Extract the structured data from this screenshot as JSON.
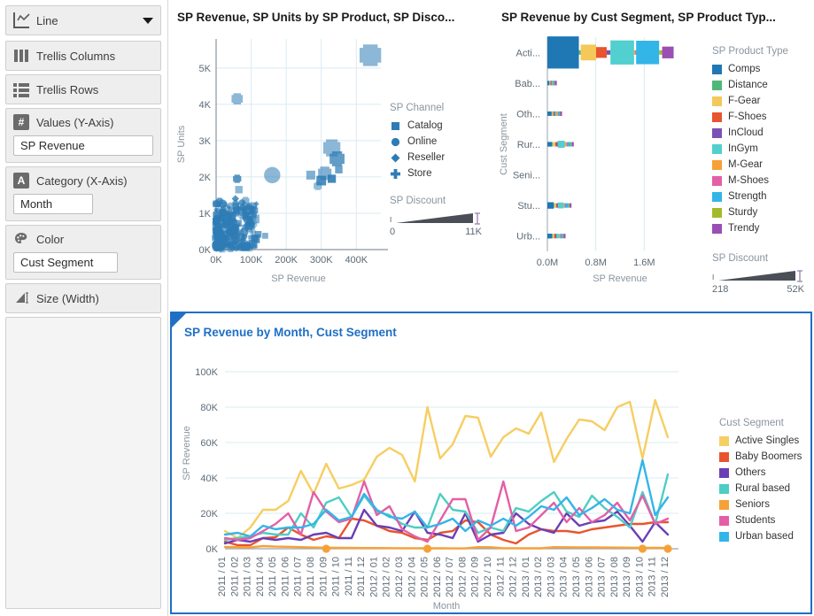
{
  "sidebar": {
    "chart_type": {
      "label": "Line",
      "icon": "line-chart-icon",
      "caret": "chevron-down-icon"
    },
    "shelves": [
      {
        "label": "Trellis Columns",
        "icon": "trellis-columns-icon"
      },
      {
        "label": "Trellis Rows",
        "icon": "trellis-rows-icon"
      }
    ],
    "values": {
      "label": "Values (Y-Axis)",
      "icon": "measure-icon",
      "field": "SP Revenue"
    },
    "category": {
      "label": "Category (X-Axis)",
      "icon": "attribute-icon",
      "field": "Month"
    },
    "color": {
      "label": "Color",
      "icon": "palette-icon",
      "field": "Cust Segment"
    },
    "size": {
      "label": "Size (Width)",
      "icon": "size-icon"
    }
  },
  "scatter": {
    "title": "SP Revenue, SP Units by SP Product, SP Disco...",
    "legend_channel_title": "SP Channel",
    "legend_discount_title": "SP Discount",
    "discount_min": "0",
    "discount_max": "11K"
  },
  "bars": {
    "title": "SP Revenue by Cust Segment, SP Product Typ...",
    "legend_title": "SP Product Type",
    "legend_discount_title": "SP Discount",
    "discount_min": "218",
    "discount_max": "52K"
  },
  "lines": {
    "title": "SP Revenue by Month, Cust Segment",
    "legend_title": "Cust Segment"
  },
  "chart_data": [
    {
      "id": "scatter",
      "type": "scatter",
      "title": "SP Revenue, SP Units by SP Product, SP Disco...",
      "xlabel": "SP Revenue",
      "ylabel": "SP Units",
      "xlim": [
        0,
        470000
      ],
      "ylim": [
        0,
        5800
      ],
      "xticks": [
        "0K",
        "100K",
        "200K",
        "300K",
        "400K"
      ],
      "xtickvals": [
        0,
        100000,
        200000,
        300000,
        400000
      ],
      "yticks": [
        "0K",
        "1K",
        "2K",
        "3K",
        "4K",
        "5K"
      ],
      "ytickvals": [
        0,
        1000,
        2000,
        3000,
        4000,
        5000
      ],
      "grid": true,
      "legend_position": "right",
      "legend_title": "SP Channel",
      "legend": [
        {
          "name": "Catalog",
          "marker": "square",
          "color": "#2e7cb5"
        },
        {
          "name": "Online",
          "marker": "circle",
          "color": "#2e7cb5"
        },
        {
          "name": "Reseller",
          "marker": "diamond",
          "color": "#2e7cb5"
        },
        {
          "name": "Store",
          "marker": "cross",
          "color": "#2e7cb5"
        }
      ],
      "size_legend": {
        "title": "SP Discount",
        "min": 0,
        "max": 11000,
        "min_label": "0",
        "max_label": "11K"
      },
      "points": [
        {
          "x": 440000,
          "y": 5350,
          "size": 58,
          "marker": "cross",
          "opacity": 0.55
        },
        {
          "x": 60000,
          "y": 4150,
          "size": 30,
          "marker": "cross",
          "opacity": 0.55
        },
        {
          "x": 330000,
          "y": 2800,
          "size": 46,
          "marker": "cross",
          "opacity": 0.55
        },
        {
          "x": 345000,
          "y": 2500,
          "size": 40,
          "marker": "cross",
          "opacity": 0.75
        },
        {
          "x": 310000,
          "y": 2100,
          "size": 36,
          "marker": "cross",
          "opacity": 0.6
        },
        {
          "x": 300000,
          "y": 1900,
          "size": 26,
          "marker": "square",
          "opacity": 0.85
        },
        {
          "x": 160000,
          "y": 2050,
          "size": 44,
          "marker": "circle",
          "opacity": 0.55
        },
        {
          "x": 270000,
          "y": 2050,
          "size": 24,
          "marker": "square",
          "opacity": 0.6
        },
        {
          "x": 330000,
          "y": 1950,
          "size": 22,
          "marker": "square",
          "opacity": 0.9
        },
        {
          "x": 350000,
          "y": 2200,
          "size": 20,
          "marker": "square",
          "opacity": 0.7
        },
        {
          "x": 290000,
          "y": 1750,
          "size": 22,
          "marker": "cross",
          "opacity": 0.5
        },
        {
          "x": 60000,
          "y": 1950,
          "size": 22,
          "marker": "cross",
          "opacity": 0.8
        },
        {
          "x": 65000,
          "y": 1650,
          "size": 20,
          "marker": "square",
          "opacity": 0.55
        },
        {
          "x": 55000,
          "y": 1400,
          "size": 20,
          "marker": "diamond",
          "opacity": 0.8
        },
        {
          "x": 80000,
          "y": 1250,
          "size": 22,
          "marker": "diamond",
          "opacity": 0.5
        },
        {
          "x": 95000,
          "y": 1200,
          "size": 20,
          "marker": "diamond",
          "opacity": 0.7
        },
        {
          "x": 75000,
          "y": 1050,
          "size": 26,
          "marker": "circle",
          "opacity": 0.7
        },
        {
          "x": 45000,
          "y": 900,
          "size": 22,
          "marker": "square",
          "opacity": 0.85
        },
        {
          "x": 30000,
          "y": 700,
          "size": 24,
          "marker": "circle",
          "opacity": 0.9
        },
        {
          "x": 120000,
          "y": 420,
          "size": 18,
          "marker": "square",
          "opacity": 0.7
        },
        {
          "x": 140000,
          "y": 380,
          "size": 16,
          "marker": "square",
          "opacity": 0.6
        },
        {
          "x": 20000,
          "y": 300,
          "size": 26,
          "marker": "circle",
          "opacity": 0.95
        },
        {
          "x": 35000,
          "y": 500,
          "size": 22,
          "marker": "diamond",
          "opacity": 0.9
        },
        {
          "x": 50000,
          "y": 600,
          "size": 20,
          "marker": "square",
          "opacity": 0.8
        },
        {
          "x": 15000,
          "y": 200,
          "size": 24,
          "marker": "cross",
          "opacity": 0.95
        },
        {
          "x": 90000,
          "y": 800,
          "size": 22,
          "marker": "circle",
          "opacity": 0.6
        },
        {
          "x": 100000,
          "y": 650,
          "size": 20,
          "marker": "square",
          "opacity": 0.65
        },
        {
          "x": 25000,
          "y": 150,
          "size": 22,
          "marker": "diamond",
          "opacity": 0.9
        },
        {
          "x": 10000,
          "y": 420,
          "size": 20,
          "marker": "square",
          "opacity": 0.9
        },
        {
          "x": 70000,
          "y": 350,
          "size": 20,
          "marker": "cross",
          "opacity": 0.7
        }
      ]
    },
    {
      "id": "stacked_bars",
      "type": "bar",
      "orientation": "horizontal",
      "stacked": true,
      "title": "SP Revenue by Cust Segment, SP Product Typ...",
      "xlabel": "SP Revenue",
      "ylabel": "Cust Segment",
      "xlim": [
        0,
        2400000
      ],
      "xticks": [
        "0.0M",
        "0.8M",
        "1.6M"
      ],
      "xtickvals": [
        0,
        800000,
        1600000
      ],
      "categories": [
        "Acti...",
        "Bab...",
        "Oth...",
        "Rur...",
        "Seni...",
        "Stu...",
        "Urb..."
      ],
      "legend_title": "SP Product Type",
      "legend_position": "right",
      "series": [
        {
          "name": "Comps",
          "color": "#1f77b4",
          "values": [
            520000,
            30000,
            70000,
            75000,
            0,
            105000,
            78000
          ]
        },
        {
          "name": "Distance",
          "color": "#4fb878",
          "values": [
            30000,
            6000,
            8000,
            14000,
            0,
            10000,
            9000
          ]
        },
        {
          "name": "F-Gear",
          "color": "#f6c council",
          "values": [
            0,
            0,
            0,
            0,
            0,
            0,
            0
          ]
        },
        {
          "name": "F-Shoes",
          "color": "#e8542e",
          "values": [
            175000,
            10000,
            14000,
            26000,
            0,
            16000,
            22000
          ]
        },
        {
          "name": "InCloud",
          "color": "#7b51b5",
          "values": [
            62000,
            8000,
            12000,
            16000,
            0,
            14000,
            12000
          ]
        },
        {
          "name": "InGym",
          "color": "#52cfcf",
          "values": [
            390000,
            22000,
            30000,
            115000,
            0,
            95000,
            52000
          ]
        },
        {
          "name": "M-Gear",
          "color": "#f6a138",
          "values": [
            22000,
            5000,
            20000,
            32000,
            0,
            16000,
            14000
          ]
        },
        {
          "name": "M-Shoes",
          "color": "#e35fa6",
          "values": [
            12000,
            5000,
            6000,
            10000,
            0,
            8000,
            7000
          ]
        },
        {
          "name": "Strength",
          "color": "#33b5e8",
          "values": [
            380000,
            18000,
            22000,
            58000,
            0,
            62000,
            38000
          ]
        },
        {
          "name": "Sturdy",
          "color": "#a2bb2a",
          "values": [
            50000,
            6000,
            8000,
            18000,
            0,
            12000,
            10000
          ]
        },
        {
          "name": "Trendy",
          "color": "#9a4fb5",
          "values": [
            190000,
            10000,
            16000,
            32000,
            0,
            26000,
            18000
          ]
        }
      ],
      "size_legend": {
        "title": "SP Discount",
        "min": 218,
        "max": 52000,
        "min_label": "218",
        "max_label": "52K"
      }
    },
    {
      "id": "line_by_month",
      "type": "line",
      "title": "SP Revenue by Month, Cust Segment",
      "xlabel": "Month",
      "ylabel": "SP Revenue",
      "ylim": [
        0,
        108000
      ],
      "yticks": [
        "0K",
        "20K",
        "40K",
        "60K",
        "80K",
        "100K"
      ],
      "ytickvals": [
        0,
        20000,
        40000,
        60000,
        80000,
        100000
      ],
      "grid": true,
      "legend_title": "Cust Segment",
      "legend_position": "right",
      "categories": [
        "2011 / 01",
        "2011 / 02",
        "2011 / 03",
        "2011 / 04",
        "2011 / 05",
        "2011 / 06",
        "2011 / 07",
        "2011 / 08",
        "2011 / 09",
        "2011 / 10",
        "2011 / 11",
        "2011 / 12",
        "2012 / 01",
        "2012 / 02",
        "2012 / 03",
        "2012 / 04",
        "2012 / 05",
        "2012 / 06",
        "2012 / 07",
        "2012 / 08",
        "2012 / 09",
        "2012 / 10",
        "2012 / 11",
        "2012 / 12",
        "2013 / 01",
        "2013 / 02",
        "2013 / 03",
        "2013 / 04",
        "2013 / 05",
        "2013 / 06",
        "2013 / 07",
        "2013 / 08",
        "2013 / 09",
        "2013 / 10",
        "2013 / 11",
        "2013 / 12"
      ],
      "series": [
        {
          "name": "Active Singles",
          "color": "#f5c council",
          "values": []
        },
        {
          "name": "Baby Boomers",
          "color": "#e8542e",
          "values": [
            4000,
            2000,
            2000,
            6000,
            6500,
            12000,
            8000,
            5000,
            7000,
            6000,
            17000,
            16000,
            13000,
            10000,
            9000,
            6000,
            5000,
            9000,
            10000,
            16000,
            15000,
            8000,
            5000,
            3000,
            8000,
            11000,
            10000,
            10000,
            9000,
            11000,
            12000,
            13000,
            14000,
            14000,
            15000,
            15000
          ]
        },
        {
          "name": "Others",
          "color": "#6a3fb5",
          "values": [
            3000,
            5000,
            4000,
            6000,
            5000,
            6000,
            5000,
            8000,
            9000,
            6000,
            6000,
            22000,
            13000,
            12000,
            10000,
            21000,
            9000,
            8000,
            6000,
            20000,
            4000,
            8000,
            9000,
            20000,
            14000,
            11000,
            9000,
            20000,
            13000,
            15000,
            16000,
            21000,
            13000,
            4000,
            15000,
            8000
          ]
        },
        {
          "name": "Rural based",
          "color": "#4ecdc4",
          "values": [
            5000,
            6000,
            7000,
            9000,
            8000,
            8000,
            20000,
            12000,
            26000,
            29000,
            18000,
            30000,
            21000,
            19000,
            14000,
            12000,
            12000,
            31000,
            22000,
            21000,
            9000,
            12000,
            10000,
            23000,
            21000,
            27000,
            32000,
            21000,
            18000,
            30000,
            23000,
            18000,
            12000,
            32000,
            14000,
            42000
          ]
        },
        {
          "name": "Seniors",
          "color": "#f6a138",
          "values": [
            1000,
            900,
            800,
            1500,
            1200,
            1100,
            900,
            700,
            600,
            500,
            450,
            400,
            400,
            350,
            300,
            280,
            260,
            240,
            220,
            200,
            900,
            850,
            300,
            280,
            260,
            240,
            900,
            850,
            800,
            750,
            700,
            650,
            600,
            550,
            500,
            450
          ]
        },
        {
          "name": "Students",
          "color": "#e35fa6",
          "values": [
            6000,
            5000,
            6000,
            10000,
            14000,
            20000,
            8000,
            32000,
            21000,
            15000,
            17000,
            38000,
            19000,
            24000,
            11000,
            7000,
            4000,
            16000,
            28000,
            28000,
            5000,
            12000,
            38000,
            10000,
            12000,
            19000,
            26000,
            15000,
            23000,
            15000,
            19000,
            26000,
            16000,
            30000,
            14000,
            17000
          ]
        },
        {
          "name": "Urban based",
          "color": "#33b5e8",
          "values": [
            8000,
            9000,
            7000,
            13000,
            11000,
            12000,
            12000,
            14000,
            22000,
            16000,
            18000,
            31000,
            22000,
            18000,
            17000,
            21000,
            12000,
            14000,
            17000,
            10000,
            16000,
            13000,
            17000,
            13000,
            18000,
            24000,
            22000,
            29000,
            19000,
            23000,
            28000,
            22000,
            20000,
            50000,
            19000,
            29000
          ]
        }
      ]
    }
  ]
}
